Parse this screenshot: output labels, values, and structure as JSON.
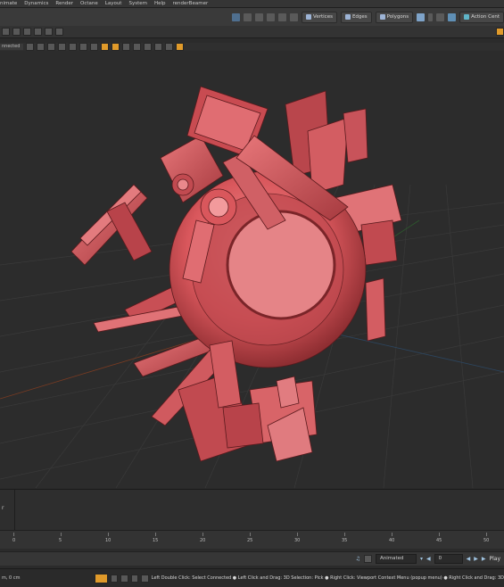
{
  "menu": [
    "nimate",
    "Dynamics",
    "Render",
    "Octane",
    "Layout",
    "System",
    "Help",
    "renderBeamer"
  ],
  "toolbar": {
    "vertices_label": "Vertices",
    "edges_label": "Edges",
    "polygons_label": "Polygons",
    "action_center_label": "Action Cent"
  },
  "viewport": {
    "selection_label": "nnected"
  },
  "ruler": {
    "ticks": [
      "0",
      "5",
      "10",
      "15",
      "20",
      "25",
      "30",
      "35",
      "40",
      "45",
      "50"
    ]
  },
  "transport": {
    "mode": "Animated",
    "frame": "0",
    "play_label": "Play"
  },
  "status": {
    "position": "m, 0 cm",
    "hint": "Left Double Click: Select Connected ● Left Click and Drag: 3D Selection: Pick ● Right Click: Viewport Context Menu (popup menu) ● Right Click and Drag: 3D"
  },
  "colors": {
    "model": "#d9575c",
    "accent": "#e09a2a"
  }
}
